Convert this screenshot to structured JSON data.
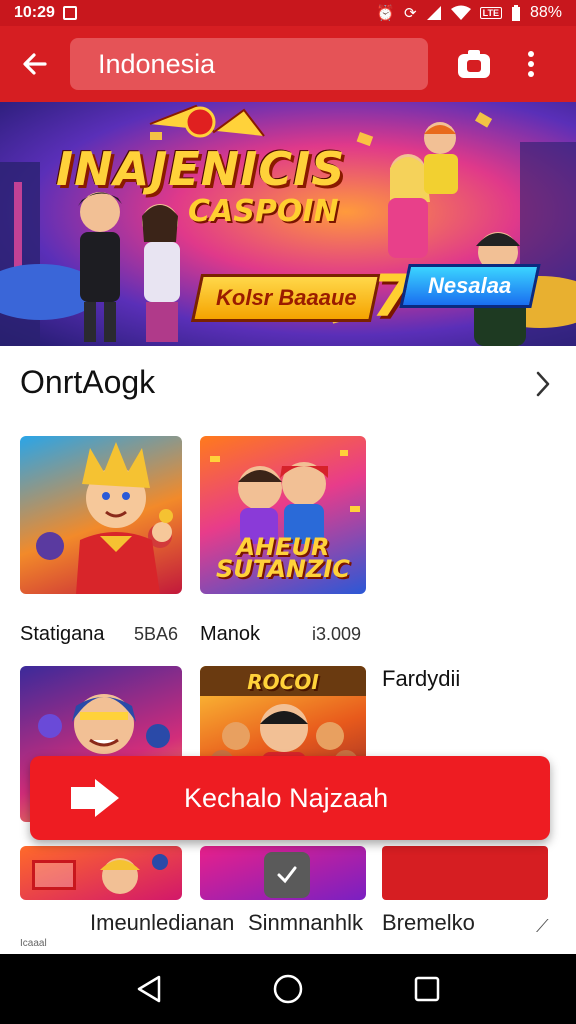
{
  "status_bar": {
    "time": "10:29",
    "battery": "88%",
    "network_badge": "LTE"
  },
  "app_bar": {
    "search_value": "Indonesia"
  },
  "banner": {
    "title": "INAJENICIS",
    "subtitle": "CASPOIN",
    "ribbon_left": "Kolsr Baaaue",
    "ribbon_number": "7",
    "ribbon_right": "Nesalaa"
  },
  "section": {
    "title": "OnrtAogk"
  },
  "games": [
    {
      "name": "Statigana",
      "meta": "5BA6"
    },
    {
      "name": "Manok",
      "meta": "i3.009"
    }
  ],
  "tile_2_caption": "AHEUR SUTANZIC",
  "tile_4_caption": "ROCOI",
  "side_label": "Fardydii",
  "cta": {
    "label": "Kechalo Najzaah"
  },
  "bottom_links": [
    "Imeunledianan",
    "Sinmnanhlk",
    "Bremelko"
  ],
  "bottom_fade_text": "Icaaal",
  "colors": {
    "brand_red": "#d61e22",
    "cta_red": "#ee1c22",
    "search_bg": "#e55357"
  },
  "icons": {
    "back": "arrow-left-icon",
    "camera": "camera-icon",
    "more": "more-vert-icon",
    "chevron": "chevron-right-icon",
    "cta": "arrow-right-icon",
    "nav_back": "triangle-back-icon",
    "nav_home": "circle-home-icon",
    "nav_recents": "square-recents-icon"
  }
}
